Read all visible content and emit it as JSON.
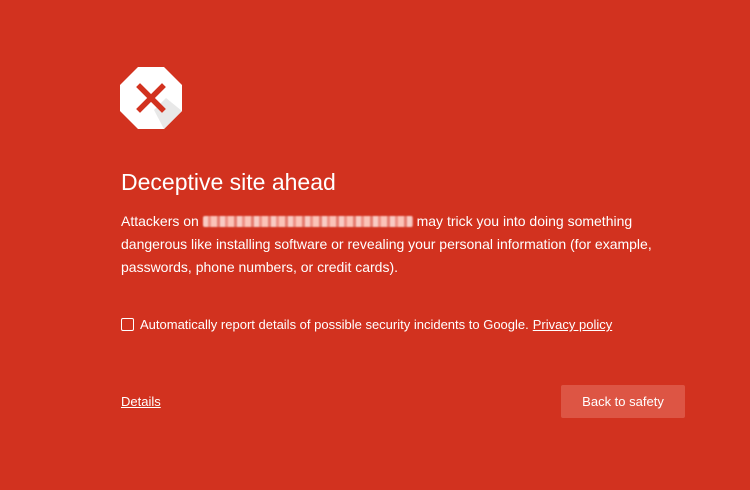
{
  "interstitial": {
    "icon": "danger-x-icon",
    "title": "Deceptive site ahead",
    "message_prefix": "Attackers on",
    "message_suffix": "may trick you into doing something dangerous like installing software or revealing your personal information (for example, passwords, phone numbers, or credit cards).",
    "report_checkbox_checked": false,
    "report_text": "Automatically report details of possible security incidents to Google.",
    "privacy_link": "Privacy policy",
    "details_link": "Details",
    "back_button": "Back to safety"
  },
  "colors": {
    "background": "#d2321f",
    "button": "#dd5544",
    "icon_x": "#d2321f",
    "text": "#ffffff"
  }
}
